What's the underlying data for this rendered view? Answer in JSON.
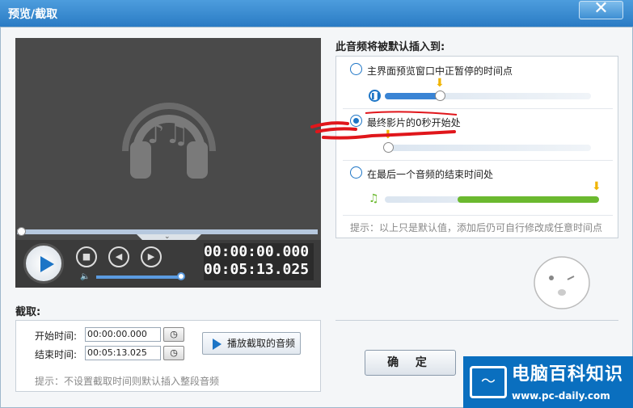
{
  "window": {
    "title": "预览/截取",
    "close_glyph": "✕"
  },
  "player": {
    "time_current": "00:00:00.000",
    "time_total": "00:05:13.025",
    "icons": [
      "headphones-music-icon",
      "play-icon",
      "stop-icon",
      "prev-icon",
      "next-icon",
      "volume-icon",
      "chevron-down-icon"
    ],
    "volume_level": 1.0,
    "seek_position": 0.0
  },
  "cut": {
    "section_label": "截取:",
    "start_label": "开始时间:",
    "start_value": "00:00:00.000",
    "end_label": "结束时间:",
    "end_value": "00:05:13.025",
    "play_button": "播放截取的音频",
    "hint": "提示：不设置截取时间则默认插入整段音频"
  },
  "insert": {
    "section_label": "此音频将被默认插入到:",
    "options": [
      {
        "label": "主界面预览窗口中正暂停的时间点",
        "selected": false,
        "position": 0.3
      },
      {
        "label": "最终影片的0秒开始处",
        "selected": true,
        "position": 0.0
      },
      {
        "label": "在最后一个音频的结束时间处",
        "selected": false,
        "position": 1.0
      }
    ],
    "hint": "提示：以上只是默认值，添加后仍可自行修改成任意时间点"
  },
  "ok_button": "确 定",
  "watermark": {
    "title": "电脑百科知识",
    "url": "www.pc-daily.com"
  },
  "colors": {
    "accent": "#1d75c6",
    "title_bar": "#3a8ed3",
    "green": "#6bb92f",
    "arrow": "#f0b400",
    "annotation": "#e0161b"
  }
}
